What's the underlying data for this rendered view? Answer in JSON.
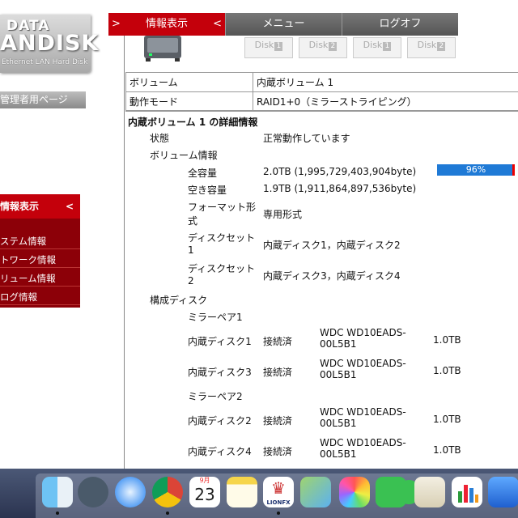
{
  "sidebar": {
    "logo_line1": "DATA",
    "logo_line2": "ANDISK",
    "logo_line3": "Ethernet LAN Hard Disk",
    "admin_tab": "管理者用ページ",
    "menu_title": "情報表示",
    "menu_arrow": "<",
    "items": [
      "ステム情報",
      "トワーク情報",
      "リューム情報",
      "ログ情報"
    ]
  },
  "topnav": {
    "active_left_arrow": ">",
    "active_label": "情報表示",
    "active_right_arrow": "<",
    "menu_label": "メニュー",
    "logoff_label": "ログオフ"
  },
  "disks": [
    "Disk",
    "Disk",
    "Disk",
    "Disk"
  ],
  "disk_nums": [
    "1",
    "2",
    "1",
    "2"
  ],
  "summary": {
    "volume_label": "ボリューム",
    "volume_value": "内蔵ボリューム 1",
    "mode_label": "動作モード",
    "mode_value": "RAID1+0（ミラーストライピング）"
  },
  "detail": {
    "title": "内蔵ボリューム 1 の詳細情報",
    "status_label": "状態",
    "status_value": "正常動作しています",
    "volinfo_label": "ボリューム情報",
    "capacity_label": "全容量",
    "capacity_value": "2.0TB (1,995,729,403,904byte)",
    "usage_percent": 96,
    "usage_text": "96%",
    "free_label": "空き容量",
    "free_value": "1.9TB (1,911,864,897,536byte)",
    "format_label_1": "フォーマット形",
    "format_label_2": "式",
    "format_value": "専用形式",
    "diskset1_label_1": "ディスクセット",
    "diskset1_label_2": "1",
    "diskset1_value": "内蔵ディスク1，内蔵ディスク2",
    "diskset2_label_1": "ディスクセット",
    "diskset2_label_2": "2",
    "diskset2_value": "内蔵ディスク3，内蔵ディスク4",
    "config_label": "構成ディスク",
    "mirror1": "ミラーペア1",
    "mirror2": "ミラーペア2",
    "disks": [
      {
        "name": "内蔵ディスク1",
        "status": "接続済",
        "model_1": "WDC WD10EADS-",
        "model_2": "00L5B1",
        "size": "1.0TB"
      },
      {
        "name": "内蔵ディスク3",
        "status": "接続済",
        "model_1": "WDC WD10EADS-",
        "model_2": "00L5B1",
        "size": "1.0TB"
      },
      {
        "name": "内蔵ディスク2",
        "status": "接続済",
        "model_1": "WDC WD10EADS-",
        "model_2": "00L5B1",
        "size": "1.0TB"
      },
      {
        "name": "内蔵ディスク4",
        "status": "接続済",
        "model_1": "WDC WD10EADS-",
        "model_2": "00L5B1",
        "size": "1.0TB"
      }
    ]
  },
  "dock": {
    "calendar_month": "9月",
    "calendar_day": "23",
    "lion_label": "LIONFX",
    "icons": [
      "finder-icon",
      "launchpad-icon",
      "safari-icon",
      "chrome-icon",
      "calendar-icon",
      "notes-icon",
      "lionfx-icon",
      "maps-icon",
      "photos-icon",
      "facetime-icon",
      "phone-icon",
      "textedit-icon",
      "numbers-icon",
      "keynote-icon"
    ]
  },
  "colors": {
    "accent_red": "#c4000b",
    "dark_red": "#8c0008",
    "bar_blue": "#1f7ad6"
  }
}
